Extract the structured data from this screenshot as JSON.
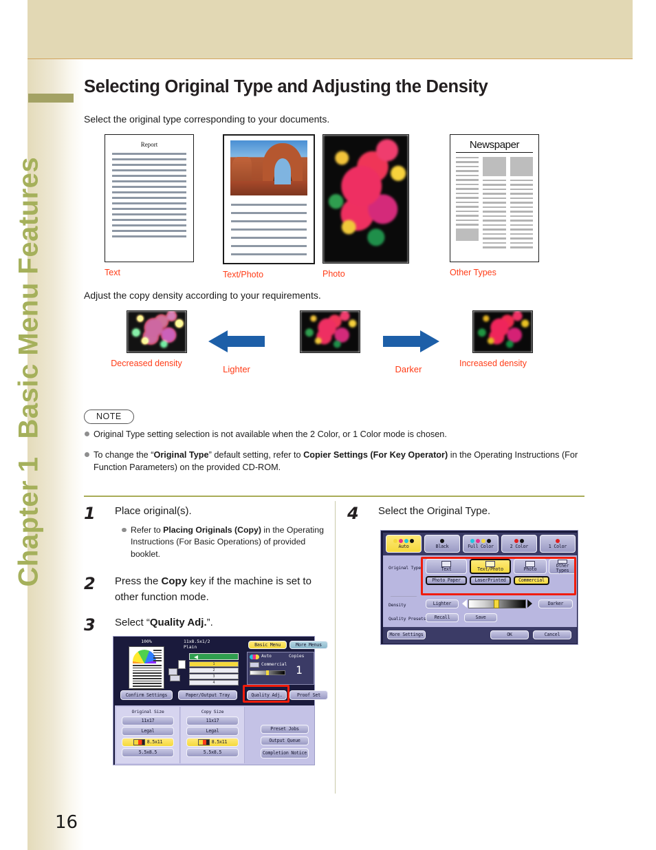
{
  "document": {
    "page_number": "16",
    "chapter_number": "Chapter 1",
    "chapter_title": "Basic Menu Features",
    "title": "Selecting Original Type and Adjusting the Density"
  },
  "original_type_section": {
    "intro": "Select the original type corresponding to your documents.",
    "samples": [
      {
        "label": "Text",
        "doc_title": "Report"
      },
      {
        "label": "Text/Photo"
      },
      {
        "label": "Photo"
      },
      {
        "label": "Other Types",
        "doc_title": "Newspaper"
      }
    ]
  },
  "density_section": {
    "intro": "Adjust the copy density according to your requirements.",
    "left_label": "Decreased density",
    "left_arrow_label": "Lighter",
    "right_arrow_label": "Darker",
    "right_label": "Increased density",
    "arrow_color": "#1d5fa8"
  },
  "note": {
    "badge": "NOTE",
    "items": [
      {
        "pre": "Original Type setting selection is not available when the 2 Color, or 1 Color mode is chosen.",
        "bold": "",
        "post": ""
      },
      {
        "pre": "To change the “",
        "bold1": "Original Type",
        "mid1": "” default setting, refer to ",
        "bold2": "Copier Settings (For Key Operator)",
        "post": " in the Operating Instructions (For Function Parameters) on the provided CD-ROM."
      }
    ]
  },
  "steps": {
    "left": [
      {
        "num": "1",
        "text": "Place original(s).",
        "sub_pre": "Refer to ",
        "sub_bold": "Placing Originals (Copy)",
        "sub_post": " in the Operating Instructions (For Basic Operations) of provided booklet."
      },
      {
        "num": "2",
        "text_pre": "Press the ",
        "text_bold": "Copy",
        "text_post": " key if the machine is set to other function mode."
      },
      {
        "num": "3",
        "text_pre": "Select “",
        "text_bold": "Quality Adj.",
        "text_post": "”."
      }
    ],
    "right": [
      {
        "num": "4",
        "text": "Select the Original Type."
      }
    ]
  },
  "lcd_basic_menu": {
    "zoom": "100%",
    "paper": "11x8.5x1/2",
    "paper_type": "Plain",
    "tab_basic": "Basic Menu",
    "tab_more": "More Menus",
    "color_mode": "Auto",
    "original_type": "Commercial",
    "copies_label": "Copies",
    "copies_value": "1",
    "btn_confirm": "Confirm Settings",
    "btn_paper_tray": "Paper/Output Tray",
    "btn_quality": "Quality Adj.",
    "btn_proof": "Proof Set",
    "original_size_label": "Original Size",
    "copy_size_label": "Copy Size",
    "sizes": [
      "11x17",
      "Legal",
      "8.5x11",
      "5.5x8.5"
    ],
    "selected_size": "8.5x11",
    "btn_preset_jobs": "Preset Jobs",
    "btn_output_queue": "Output Queue",
    "btn_completion": "Completion Notice",
    "highlight_color": "#f01c0b"
  },
  "lcd_quality_adj": {
    "color_modes": [
      {
        "label": "Auto",
        "selected": true
      },
      {
        "label": "Black",
        "selected": false
      },
      {
        "label": "Full Color",
        "selected": false
      },
      {
        "label": "2 Color",
        "selected": false
      },
      {
        "label": "1 Color",
        "selected": false
      }
    ],
    "original_type_label": "Original Type",
    "original_types_row1": [
      {
        "label": "Text",
        "selected": false
      },
      {
        "label": "Text/Photo",
        "selected": true
      },
      {
        "label": "Photo",
        "selected": false
      },
      {
        "label": "Other Types",
        "selected": false
      }
    ],
    "original_types_row2": [
      {
        "label": "Photo Paper",
        "selected": false
      },
      {
        "label": "LaserPrinted",
        "selected": false
      },
      {
        "label": "Commercial",
        "selected": true
      }
    ],
    "density_label": "Density",
    "btn_lighter": "Lighter",
    "btn_darker": "Darker",
    "quality_presets_label": "Quality Presets",
    "btn_recall": "Recall",
    "btn_save": "Save",
    "btn_more_settings": "More Settings",
    "btn_ok": "OK",
    "btn_cancel": "Cancel",
    "highlight_color": "#f01c0b"
  }
}
